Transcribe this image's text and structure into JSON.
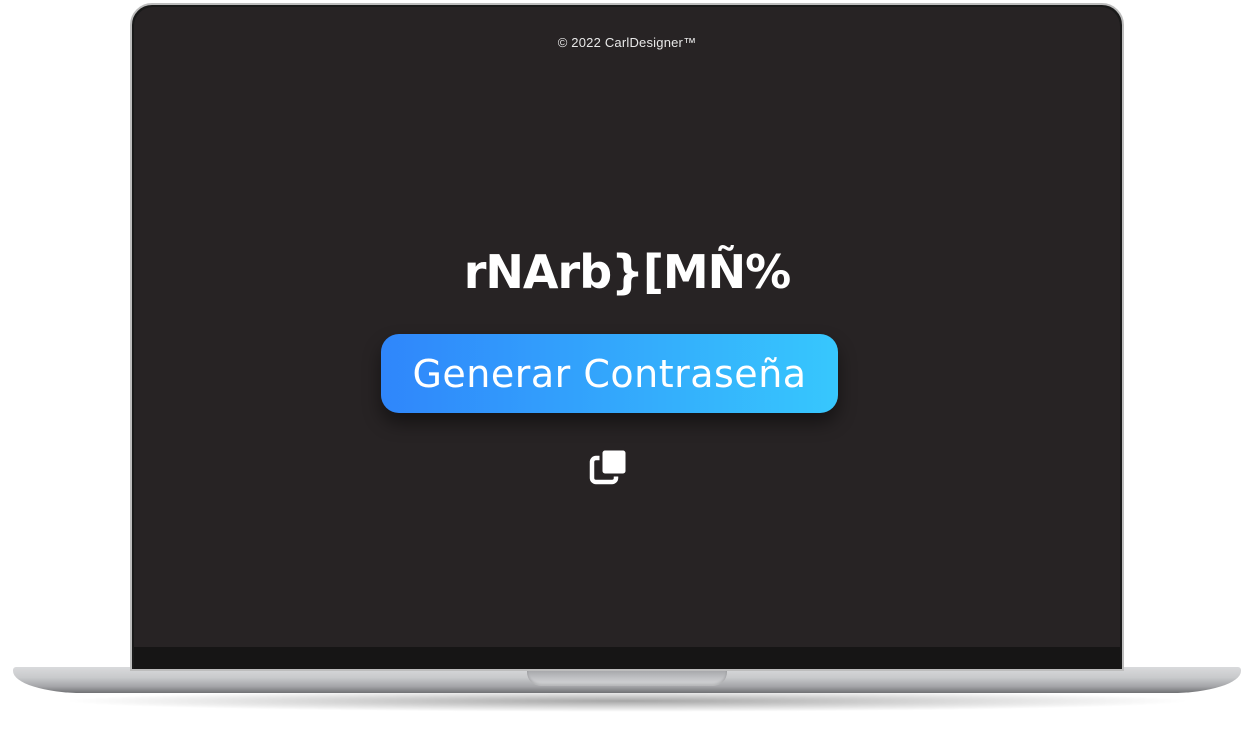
{
  "footer": {
    "copyright": "© 2022 CarlDesigner™"
  },
  "generator": {
    "password": "rNArb}[MÑ%",
    "button_label": "Generar Contraseña",
    "copy_icon": "copy-icon"
  },
  "colors": {
    "screen_background": "#272324",
    "button_gradient_start": "#2f86fb",
    "button_gradient_end": "#37c7fd",
    "text": "#ffffff"
  }
}
